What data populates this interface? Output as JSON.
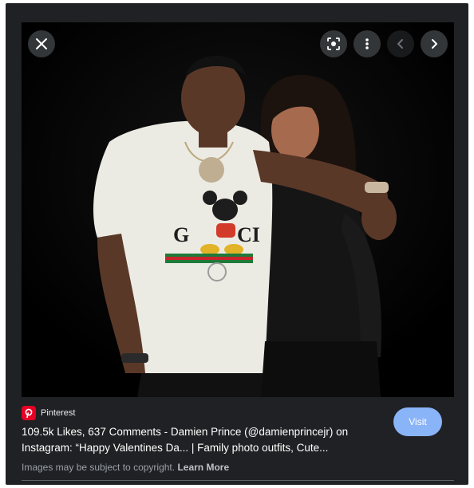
{
  "viewer": {
    "close_icon": "close-icon",
    "lens_icon": "google-lens-icon",
    "more_icon": "more-vert-icon",
    "prev_icon": "chevron-left-icon",
    "next_icon": "chevron-right-icon"
  },
  "image": {
    "subject": "photo"
  },
  "source": {
    "name": "Pinterest",
    "logo_icon": "pinterest-icon",
    "brand_color": "#e60023"
  },
  "result": {
    "title": "109.5k Likes, 637 Comments - Damien Prince (@damienprincejr) on Instagram: “Happy Valentines Da... | Family photo outfits, Cute...",
    "visit_label": "Visit"
  },
  "footer": {
    "copyright_text": "Images may be subject to copyright.",
    "learn_more_label": "Learn More"
  },
  "colors": {
    "panel_bg": "#202124",
    "visit_button": "#8ab4f8",
    "muted_text": "#9aa0a6"
  }
}
